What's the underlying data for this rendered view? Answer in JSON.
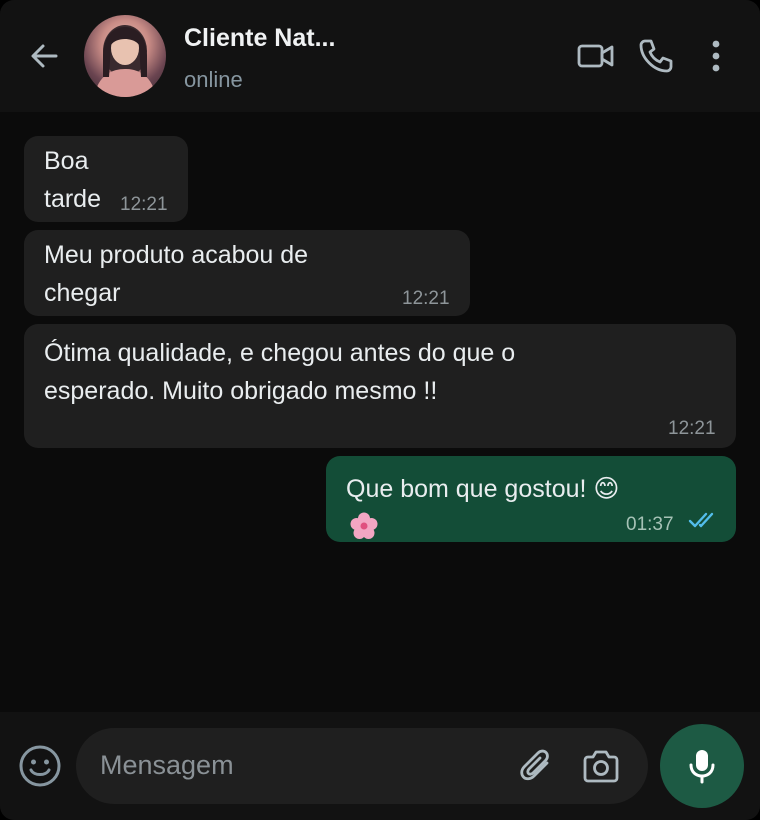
{
  "header": {
    "contact_name": "Cliente Nat...",
    "status": "online",
    "icons": [
      "back-arrow-icon",
      "video-call-icon",
      "phone-icon",
      "more-vertical-icon"
    ]
  },
  "messages": [
    {
      "direction": "incoming",
      "text": "Boa\ntarde",
      "time": "12:21"
    },
    {
      "direction": "incoming",
      "text": "Meu produto acabou de\nchegar",
      "time": "12:21"
    },
    {
      "direction": "incoming",
      "text": "Ótima qualidade, e chegou antes do que o\nesperado. Muito obrigado mesmo !!",
      "time": "12:21"
    },
    {
      "direction": "outgoing",
      "text": "Que bom que gostou! 😊",
      "time": "01:37",
      "status": "read"
    }
  ],
  "composer": {
    "placeholder": "Mensagem",
    "icons": [
      "emoji-icon",
      "attachment-icon",
      "camera-icon",
      "microphone-icon"
    ]
  },
  "colors": {
    "background": "#0b0b0b",
    "header": "#121212",
    "incoming_bubble": "#1f1f1f",
    "outgoing_bubble": "#134d37",
    "read_ticks": "#53bdeb",
    "mic_button": "#1d5a44"
  }
}
